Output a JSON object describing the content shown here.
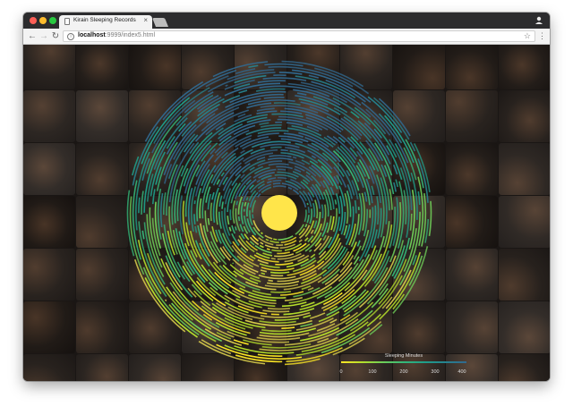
{
  "browser": {
    "tab_title": "Kirain Sleeping Records",
    "tab_close": "×",
    "url_host": "localhost",
    "url_rest": ":9999/index5.html",
    "info_symbol": "i",
    "star_symbol": "☆",
    "menu_symbol": "⋮",
    "back_symbol": "←",
    "forward_symbol": "→",
    "reload_symbol": "↻"
  },
  "visualization": {
    "center_circle_color": "#ffe54a",
    "ring_colors": [
      "#fde725",
      "#d4c84a",
      "#b5de2b",
      "#6ece58",
      "#35b779",
      "#1f9e89",
      "#26828e",
      "#31688e"
    ],
    "background": "#1a1614"
  },
  "legend": {
    "title": "Sleeping Minutes",
    "ticks": [
      "0",
      "100",
      "200",
      "300",
      "400"
    ],
    "tick_values": [
      0,
      100,
      200,
      300,
      400
    ]
  }
}
